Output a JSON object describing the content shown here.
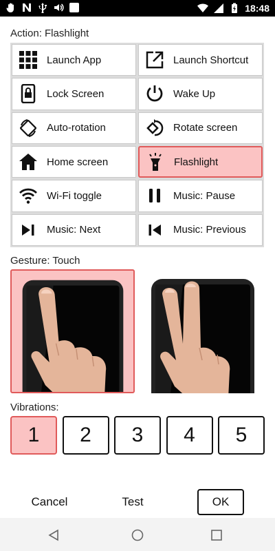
{
  "status_bar": {
    "time": "18:48",
    "left_icons": [
      "hand-icon",
      "n-icon",
      "usb-icon",
      "volume-icon",
      "square-icon"
    ],
    "right_icons": [
      "wifi-icon",
      "signal-icon",
      "battery-charging-icon"
    ]
  },
  "action": {
    "label": "Action: Flashlight",
    "items": [
      {
        "label": "Launch App",
        "icon": "grid-icon",
        "selected": false
      },
      {
        "label": "Launch Shortcut",
        "icon": "external-link-icon",
        "selected": false
      },
      {
        "label": "Lock Screen",
        "icon": "lock-phone-icon",
        "selected": false
      },
      {
        "label": "Wake Up",
        "icon": "power-icon",
        "selected": false
      },
      {
        "label": "Auto-rotation",
        "icon": "auto-rotate-icon",
        "selected": false
      },
      {
        "label": "Rotate screen",
        "icon": "rotate-screen-icon",
        "selected": false
      },
      {
        "label": "Home screen",
        "icon": "home-icon",
        "selected": false
      },
      {
        "label": "Flashlight",
        "icon": "flashlight-icon",
        "selected": true
      },
      {
        "label": "Wi-Fi toggle",
        "icon": "wifi-icon",
        "selected": false
      },
      {
        "label": "Music: Pause",
        "icon": "pause-icon",
        "selected": false
      },
      {
        "label": "Music: Next",
        "icon": "skip-next-icon",
        "selected": false
      },
      {
        "label": "Music: Previous",
        "icon": "skip-previous-icon",
        "selected": false
      }
    ]
  },
  "gesture": {
    "label": "Gesture: Touch",
    "options": [
      {
        "name": "one-finger-touch",
        "selected": true
      },
      {
        "name": "two-finger-touch",
        "selected": false
      }
    ]
  },
  "vibrations": {
    "label": "Vibrations:",
    "options": [
      "1",
      "2",
      "3",
      "4",
      "5"
    ],
    "selected": "1"
  },
  "footer": {
    "cancel": "Cancel",
    "test": "Test",
    "ok": "OK"
  },
  "colors": {
    "selected_bg": "#fbc3c3",
    "selected_border": "#e05a5a"
  }
}
